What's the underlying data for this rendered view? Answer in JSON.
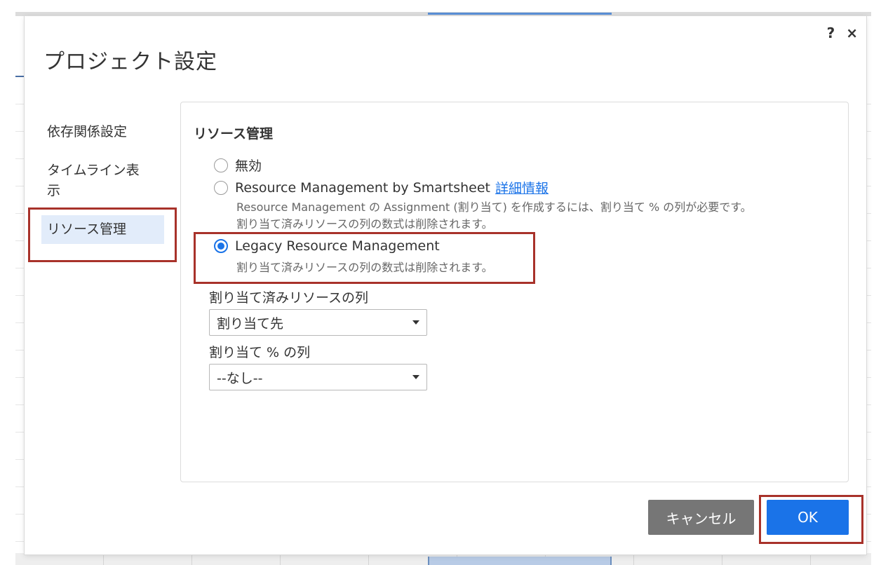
{
  "dialog": {
    "title": "プロジェクト設定",
    "help_icon": "?",
    "close_icon": "×"
  },
  "nav": {
    "items": [
      {
        "label": "依存関係設定",
        "active": false
      },
      {
        "label": "タイムライン表示",
        "active": false
      },
      {
        "label": "リソース管理",
        "active": true
      }
    ]
  },
  "resource": {
    "section_title": "リソース管理",
    "options": [
      {
        "label": "無効",
        "checked": false
      },
      {
        "label": "Resource Management by Smartsheet",
        "link": "詳細情報",
        "checked": false,
        "note_line1": "Resource Management の Assignment (割り当て) を作成するには、割り当て % の列が必要です。",
        "note_line2": "割り当て済みリソースの列の数式は削除されます。"
      },
      {
        "label": "Legacy Resource Management",
        "checked": true,
        "note_line1": "割り当て済みリソースの列の数式は削除されます。"
      }
    ],
    "assigned_column": {
      "label": "割り当て済みリソースの列",
      "value": "割り当て先"
    },
    "percent_column": {
      "label": "割り当て % の列",
      "value": "--なし--"
    }
  },
  "buttons": {
    "cancel": "キャンセル",
    "ok": "OK"
  },
  "colors": {
    "accent": "#1a73e8",
    "highlight": "#a8322a",
    "cancel_bg": "#767676",
    "nav_active_bg": "#e2ecfa"
  }
}
